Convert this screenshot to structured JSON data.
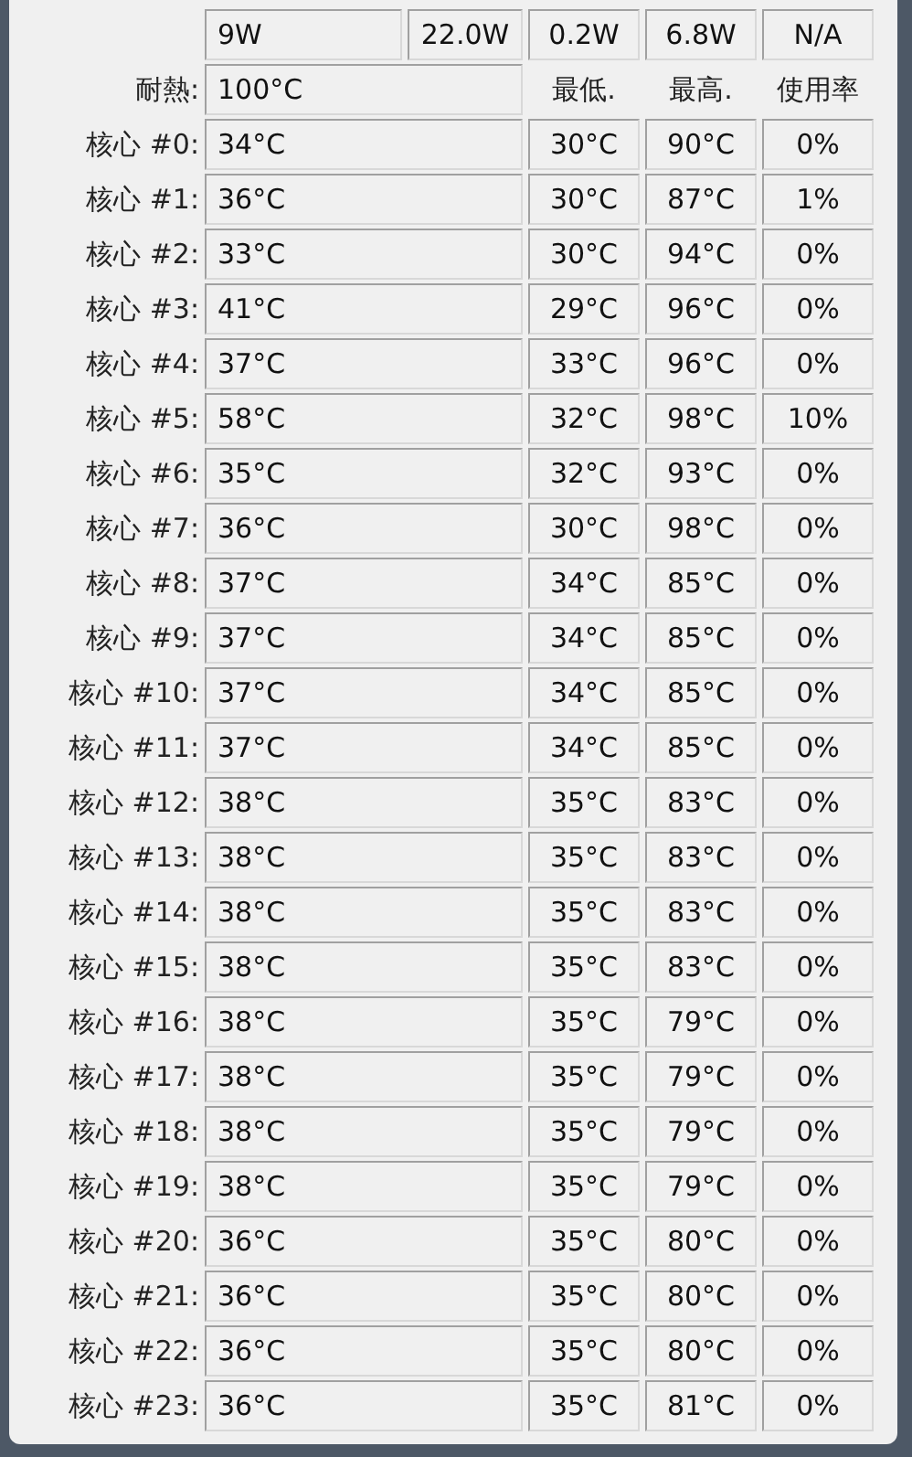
{
  "power": {
    "cells": [
      "9W",
      "22.0W",
      "0.2W",
      "6.8W",
      "N/A"
    ]
  },
  "tjmax": {
    "label": "耐熱:",
    "value": "100°C"
  },
  "headers": [
    "最低.",
    "最高.",
    "使用率"
  ],
  "cores": [
    {
      "label": "核心 #0:",
      "temp": "34°C",
      "min": "30°C",
      "max": "90°C",
      "usage": "0%"
    },
    {
      "label": "核心 #1:",
      "temp": "36°C",
      "min": "30°C",
      "max": "87°C",
      "usage": "1%"
    },
    {
      "label": "核心 #2:",
      "temp": "33°C",
      "min": "30°C",
      "max": "94°C",
      "usage": "0%"
    },
    {
      "label": "核心 #3:",
      "temp": "41°C",
      "min": "29°C",
      "max": "96°C",
      "usage": "0%"
    },
    {
      "label": "核心 #4:",
      "temp": "37°C",
      "min": "33°C",
      "max": "96°C",
      "usage": "0%"
    },
    {
      "label": "核心 #5:",
      "temp": "58°C",
      "min": "32°C",
      "max": "98°C",
      "usage": "10%"
    },
    {
      "label": "核心 #6:",
      "temp": "35°C",
      "min": "32°C",
      "max": "93°C",
      "usage": "0%"
    },
    {
      "label": "核心 #7:",
      "temp": "36°C",
      "min": "30°C",
      "max": "98°C",
      "usage": "0%"
    },
    {
      "label": "核心 #8:",
      "temp": "37°C",
      "min": "34°C",
      "max": "85°C",
      "usage": "0%"
    },
    {
      "label": "核心 #9:",
      "temp": "37°C",
      "min": "34°C",
      "max": "85°C",
      "usage": "0%"
    },
    {
      "label": "核心 #10:",
      "temp": "37°C",
      "min": "34°C",
      "max": "85°C",
      "usage": "0%"
    },
    {
      "label": "核心 #11:",
      "temp": "37°C",
      "min": "34°C",
      "max": "85°C",
      "usage": "0%"
    },
    {
      "label": "核心 #12:",
      "temp": "38°C",
      "min": "35°C",
      "max": "83°C",
      "usage": "0%"
    },
    {
      "label": "核心 #13:",
      "temp": "38°C",
      "min": "35°C",
      "max": "83°C",
      "usage": "0%"
    },
    {
      "label": "核心 #14:",
      "temp": "38°C",
      "min": "35°C",
      "max": "83°C",
      "usage": "0%"
    },
    {
      "label": "核心 #15:",
      "temp": "38°C",
      "min": "35°C",
      "max": "83°C",
      "usage": "0%"
    },
    {
      "label": "核心 #16:",
      "temp": "38°C",
      "min": "35°C",
      "max": "79°C",
      "usage": "0%"
    },
    {
      "label": "核心 #17:",
      "temp": "38°C",
      "min": "35°C",
      "max": "79°C",
      "usage": "0%"
    },
    {
      "label": "核心 #18:",
      "temp": "38°C",
      "min": "35°C",
      "max": "79°C",
      "usage": "0%"
    },
    {
      "label": "核心 #19:",
      "temp": "38°C",
      "min": "35°C",
      "max": "79°C",
      "usage": "0%"
    },
    {
      "label": "核心 #20:",
      "temp": "36°C",
      "min": "35°C",
      "max": "80°C",
      "usage": "0%"
    },
    {
      "label": "核心 #21:",
      "temp": "36°C",
      "min": "35°C",
      "max": "80°C",
      "usage": "0%"
    },
    {
      "label": "核心 #22:",
      "temp": "36°C",
      "min": "35°C",
      "max": "80°C",
      "usage": "0%"
    },
    {
      "label": "核心 #23:",
      "temp": "36°C",
      "min": "35°C",
      "max": "81°C",
      "usage": "0%"
    }
  ]
}
